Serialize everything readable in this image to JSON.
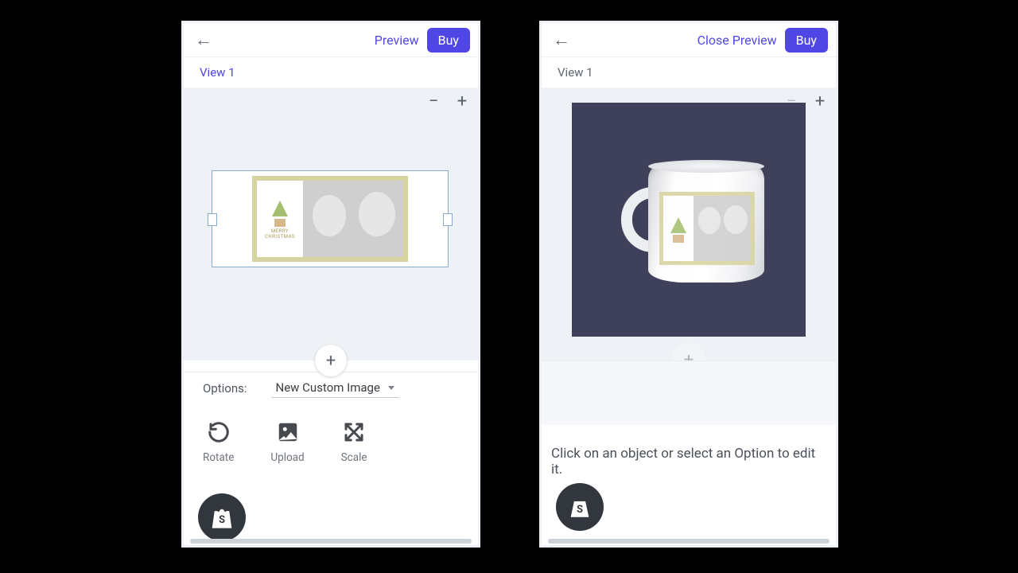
{
  "left": {
    "header": {
      "preview": "Preview",
      "buy": "Buy"
    },
    "tab": "View 1",
    "options_label": "Options:",
    "options_value": "New Custom Image",
    "tools": {
      "rotate": "Rotate",
      "upload": "Upload",
      "scale": "Scale"
    },
    "card_text": "MERRY CHRISTMAS"
  },
  "right": {
    "header": {
      "close_preview": "Close Preview",
      "buy": "Buy"
    },
    "tab": "View 1",
    "hint": "Click on an object or select an Option to edit it."
  }
}
